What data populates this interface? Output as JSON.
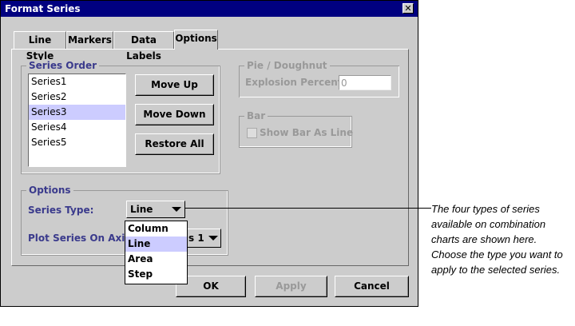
{
  "window": {
    "title": "Format Series",
    "close_glyph": "✕"
  },
  "tabs": [
    {
      "label": "Line Style"
    },
    {
      "label": "Markers"
    },
    {
      "label": "Data Labels"
    },
    {
      "label": "Options"
    }
  ],
  "series_order": {
    "title": "Series Order",
    "items": [
      "Series1",
      "Series2",
      "Series3",
      "Series4",
      "Series5"
    ],
    "selected": "Series3",
    "move_up": "Move Up",
    "move_down": "Move Down",
    "restore_all": "Restore All"
  },
  "pie": {
    "title": "Pie / Doughnut",
    "explosion_label": "Explosion Percent:",
    "explosion_value": "0"
  },
  "bar": {
    "title": "Bar",
    "show_bar_as_line": "Show Bar As Line"
  },
  "options": {
    "title": "Options",
    "series_type_label": "Series Type:",
    "series_type_value": "Line",
    "plot_axis_label": "Plot Series On Axis:",
    "plot_axis_value_visible": "s 1",
    "dropdown_options": [
      "Column",
      "Line",
      "Area",
      "Step"
    ],
    "dropdown_highlighted": "Line"
  },
  "footer": {
    "ok": "OK",
    "apply": "Apply",
    "cancel": "Cancel"
  },
  "annotation": {
    "line1": "The four types of series",
    "line2": "available on combination",
    "line3": "charts are shown here.",
    "line4": "Choose the type you want to",
    "line5": "apply to the selected series."
  }
}
